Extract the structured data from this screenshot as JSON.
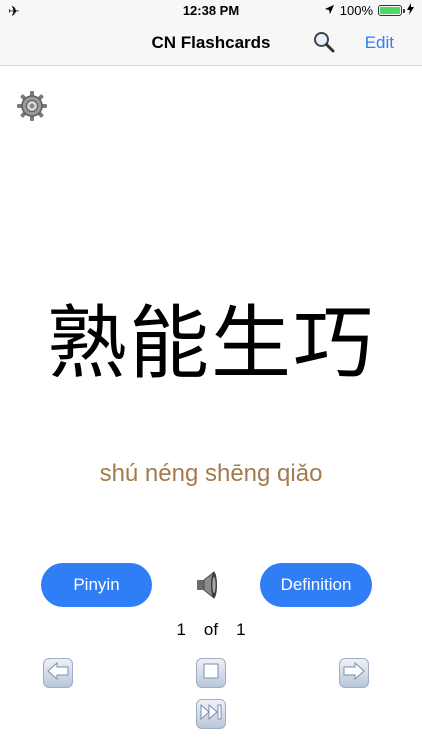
{
  "status_bar": {
    "time": "12:38 PM",
    "battery_percent": "100%",
    "battery_level": 1.0,
    "icons": [
      "airplane-icon",
      "location-arrow-icon",
      "battery-icon",
      "charging-bolt-icon"
    ]
  },
  "nav": {
    "title": "CN Flashcards",
    "edit_label": "Edit",
    "search_icon": "search-icon"
  },
  "settings": {
    "icon": "gear-icon"
  },
  "card": {
    "chinese": "熟能生巧",
    "pinyin": "shú néng shēng qiǎo"
  },
  "buttons": {
    "pinyin_label": "Pinyin",
    "definition_label": "Definition",
    "speaker_icon": "speaker-icon"
  },
  "counter": {
    "current": "1",
    "separator": "of",
    "total": "1"
  },
  "controls": {
    "prev_icon": "arrow-left-icon",
    "stop_icon": "stop-icon",
    "next_icon": "arrow-right-icon",
    "skip_icon": "skip-to-end-icon"
  },
  "colors": {
    "accent": "#2f7ef6",
    "pinyin_text": "#a27b4e",
    "battery_green": "#4cd964"
  }
}
